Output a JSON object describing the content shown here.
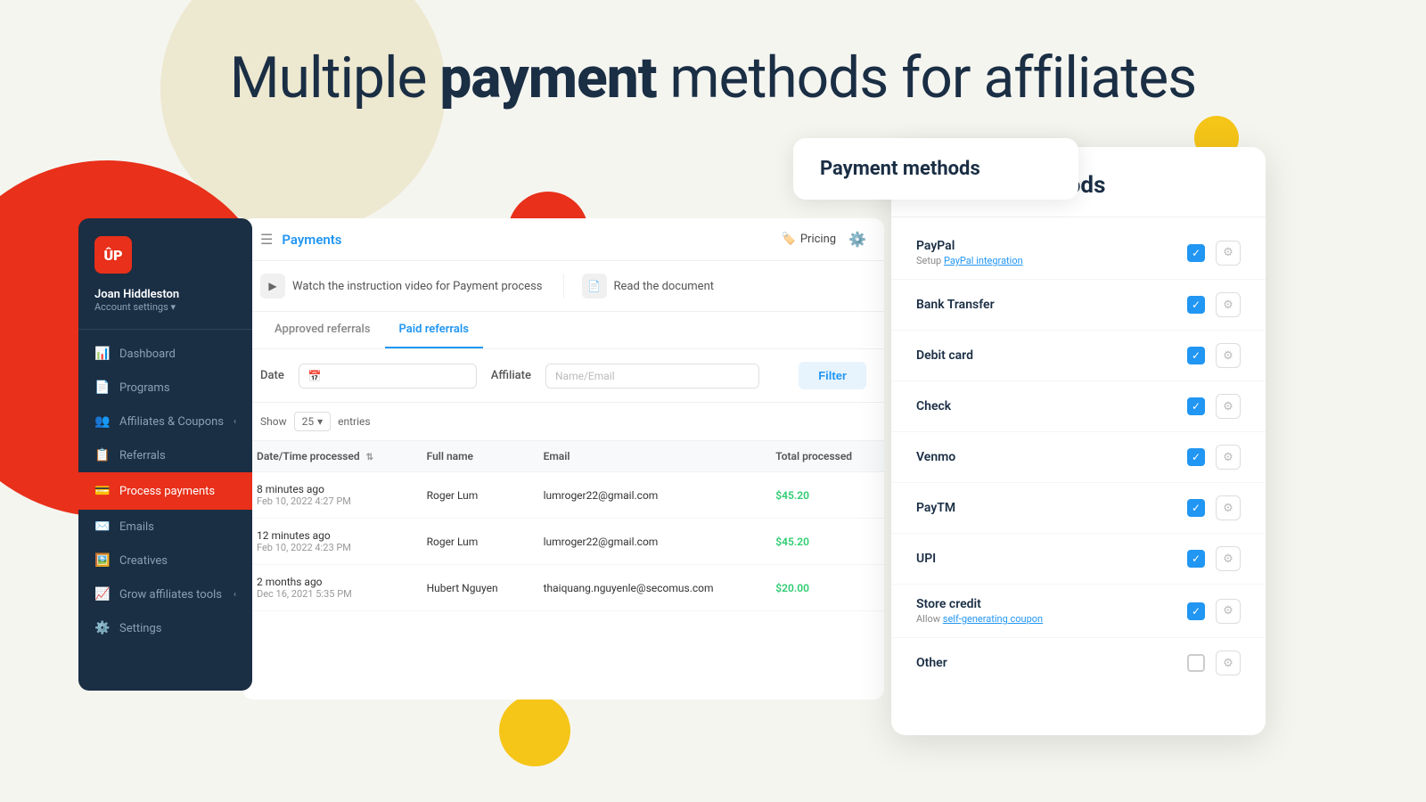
{
  "page": {
    "title": "Multiple payment methods for affiliates",
    "title_normal": "Multiple ",
    "title_bold": "payment",
    "title_rest": " methods for affiliates"
  },
  "sidebar": {
    "logo_text": "ÛP",
    "user_name": "Joan Hiddleston",
    "account_settings": "Account settings ▾",
    "items": [
      {
        "id": "dashboard",
        "label": "Dashboard",
        "icon": "📊"
      },
      {
        "id": "programs",
        "label": "Programs",
        "icon": "📄"
      },
      {
        "id": "affiliates",
        "label": "Affiliates & Coupons",
        "icon": "👥",
        "has_chevron": true
      },
      {
        "id": "referrals",
        "label": "Referrals",
        "icon": "📋"
      },
      {
        "id": "process-payments",
        "label": "Process payments",
        "icon": "💳",
        "active": true
      },
      {
        "id": "emails",
        "label": "Emails",
        "icon": "✉️"
      },
      {
        "id": "creatives",
        "label": "Creatives",
        "icon": "🖼️"
      },
      {
        "id": "grow-tools",
        "label": "Grow affiliates tools",
        "icon": "📈",
        "has_chevron": true
      },
      {
        "id": "settings",
        "label": "Settings",
        "icon": "⚙️"
      }
    ]
  },
  "main_panel": {
    "title": "Payments",
    "pricing_label": "Pricing",
    "video_link": "Watch the instruction video for Payment process",
    "doc_link": "Read the document",
    "tabs": [
      {
        "id": "approved",
        "label": "Approved referrals"
      },
      {
        "id": "paid",
        "label": "Paid referrals",
        "active": true
      }
    ],
    "filter": {
      "date_label": "Date",
      "affiliate_label": "Affiliate",
      "affiliate_placeholder": "Name/Email",
      "button_label": "Filter"
    },
    "show_entries": {
      "label_before": "Show",
      "value": "25",
      "label_after": "entries"
    },
    "table": {
      "columns": [
        {
          "id": "datetime",
          "label": "Date/Time processed",
          "sortable": true
        },
        {
          "id": "fullname",
          "label": "Full name"
        },
        {
          "id": "email",
          "label": "Email"
        },
        {
          "id": "total",
          "label": "Total processed"
        }
      ],
      "rows": [
        {
          "date_relative": "8 minutes ago",
          "date_full": "Feb 10, 2022 4:27 PM",
          "fullname": "Roger Lum",
          "email": "lumroger22@gmail.com",
          "total": "$45.20"
        },
        {
          "date_relative": "12 minutes ago",
          "date_full": "Feb 10, 2022 4:23 PM",
          "fullname": "Roger Lum",
          "email": "lumroger22@gmail.com",
          "total": "$45.20"
        },
        {
          "date_relative": "2 months ago",
          "date_full": "Dec 16, 2021 5:35 PM",
          "fullname": "Hubert Nguyen",
          "email": "thaiquang.nguyenle@secomus.com",
          "total": "$20.00"
        }
      ]
    }
  },
  "payment_methods_card": {
    "title": "Payment methods",
    "items": [
      {
        "id": "paypal",
        "name": "PayPal",
        "sub": "Setup PayPal integration",
        "sub_link": true,
        "checked": true
      },
      {
        "id": "bank-transfer",
        "name": "Bank Transfer",
        "sub": "",
        "checked": true
      },
      {
        "id": "debit-card",
        "name": "Debit card",
        "sub": "",
        "checked": true
      },
      {
        "id": "check",
        "name": "Check",
        "sub": "",
        "checked": true
      },
      {
        "id": "venmo",
        "name": "Venmo",
        "sub": "",
        "checked": true
      },
      {
        "id": "paytm",
        "name": "PayTM",
        "sub": "",
        "checked": true
      },
      {
        "id": "upi",
        "name": "UPI",
        "sub": "",
        "checked": true
      },
      {
        "id": "store-credit",
        "name": "Store credit",
        "sub": "Allow self-generating coupon",
        "sub_link": true,
        "checked": true
      },
      {
        "id": "other",
        "name": "Other",
        "sub": "",
        "checked": false
      }
    ]
  },
  "colors": {
    "red": "#e8301a",
    "blue": "#2196f3",
    "dark": "#1a2e44",
    "green": "#2ecc71",
    "yellow": "#f5c518"
  }
}
